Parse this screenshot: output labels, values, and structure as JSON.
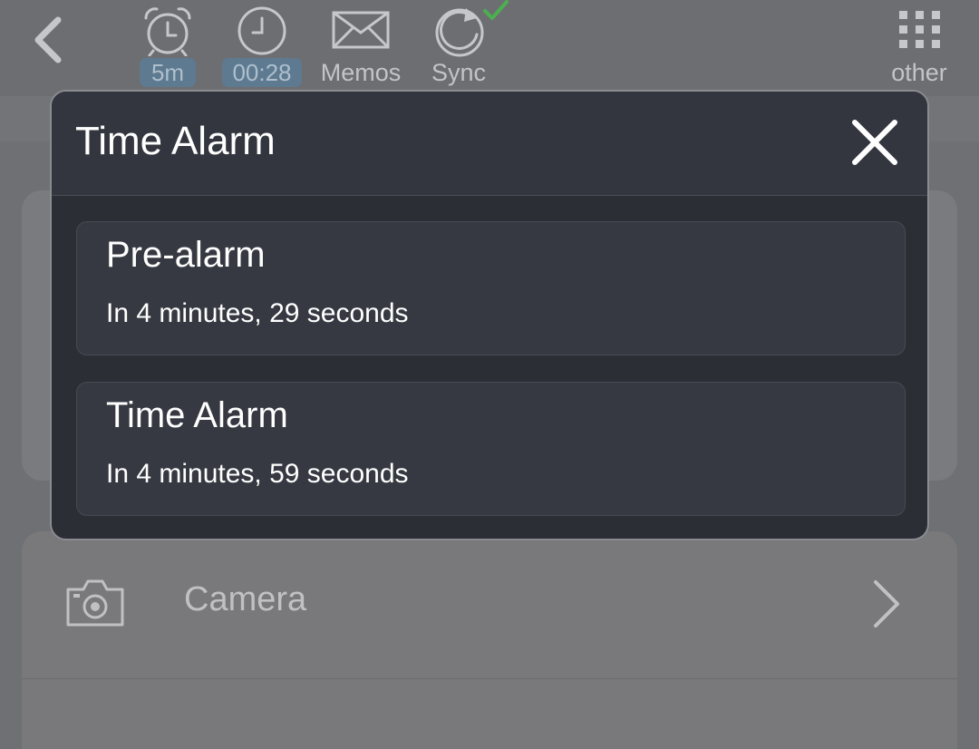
{
  "toolbar": {
    "tools": {
      "alarm": {
        "badge": "5m"
      },
      "timer": {
        "badge": "00:28"
      },
      "memos": {
        "label": "Memos"
      },
      "sync": {
        "label": "Sync"
      },
      "other": {
        "label": "other"
      }
    },
    "icons": [
      "back-chevron-icon",
      "alarm-clock-icon",
      "clock-icon",
      "envelope-icon",
      "sync-icon",
      "check-icon",
      "grid-menu-icon"
    ]
  },
  "dialog": {
    "title": "Time Alarm",
    "alarms": [
      {
        "name": "Pre-alarm",
        "time": "In 4 minutes, 29 seconds"
      },
      {
        "name": "Time Alarm",
        "time": "In 4 minutes, 59 seconds"
      }
    ]
  },
  "background": {
    "rows": [
      {
        "label": "Camera",
        "icon": "camera-icon"
      }
    ]
  },
  "colors": {
    "dialog_bg": "#2b2e35",
    "card_bg": "#363941",
    "badge_bg": "#5e7a90",
    "sync_check": "#4caf50",
    "overlay_bg": "#6f7073"
  }
}
